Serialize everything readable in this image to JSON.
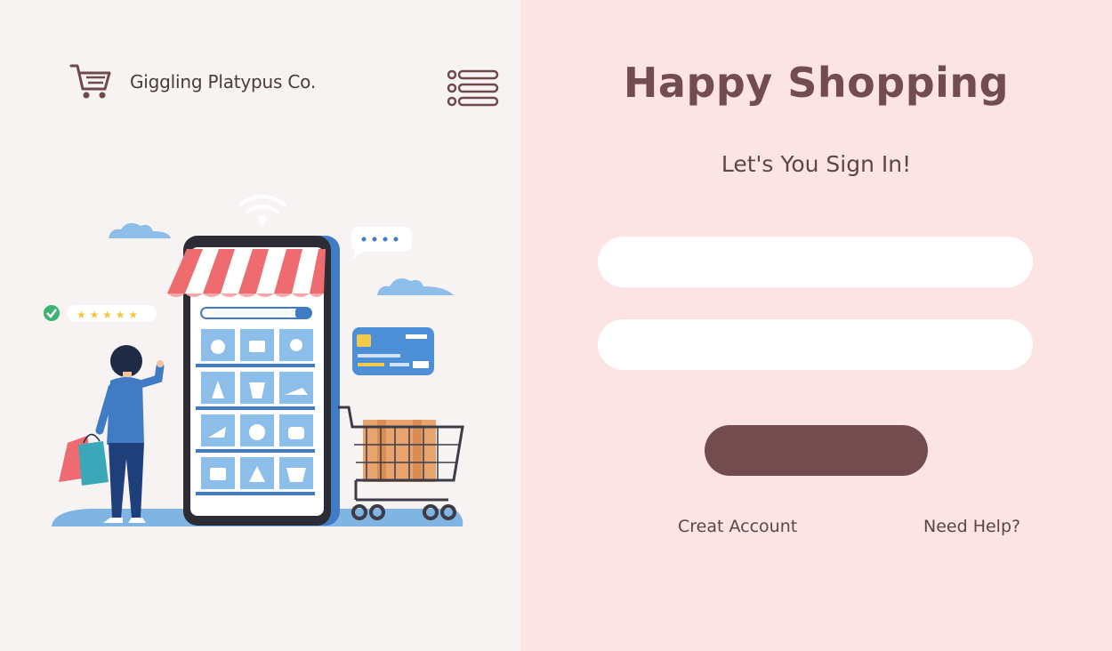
{
  "brand": {
    "name": "Giggling Platypus Co.",
    "logo_icon": "shopping-cart-icon"
  },
  "header": {
    "menu_icon": "list-menu-icon"
  },
  "hero": {
    "illustration": "online-shopping-phone-store-illustration"
  },
  "signin": {
    "title": "Happy Shopping",
    "subtitle": "Let's You Sign In!",
    "username_value": "",
    "password_value": "",
    "submit_label": "",
    "create_account": "Creat Account",
    "need_help": "Need Help?"
  },
  "colors": {
    "left_bg": "#f8f3f3",
    "right_bg": "#fce4e4",
    "accent": "#734c4f",
    "input_bg": "#ffffff"
  }
}
